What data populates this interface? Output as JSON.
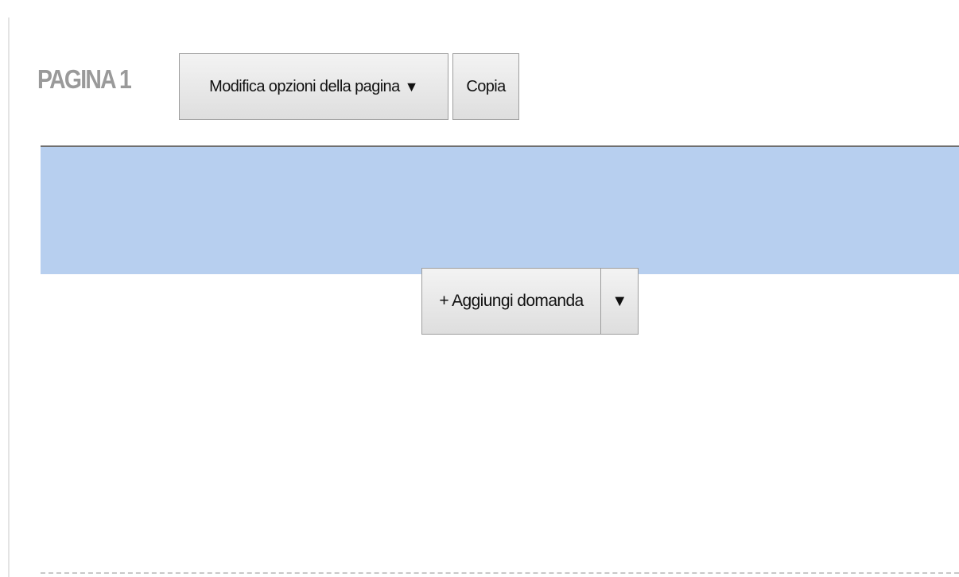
{
  "page": {
    "title": "PAGINA 1",
    "page_options_label": "Modifica opzioni della pagina",
    "copy_label": "Copia"
  },
  "icons": {
    "dropdown_arrow": "▼"
  },
  "actions": {
    "add_question_label": "+ Aggiungi domanda"
  },
  "colors": {
    "page_band": "#b7cfef",
    "title": "#9a9a9a"
  }
}
